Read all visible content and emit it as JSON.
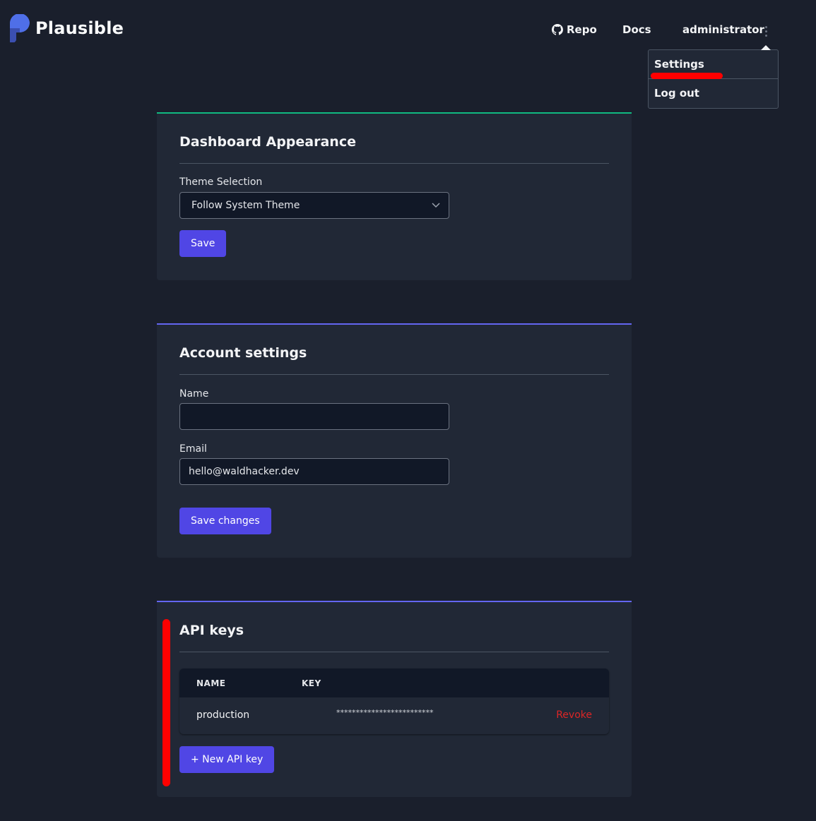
{
  "header": {
    "brand": "Plausible",
    "nav": {
      "repo": "Repo",
      "docs": "Docs",
      "user": "administrator"
    }
  },
  "user_menu": {
    "items": [
      {
        "label": "Settings"
      },
      {
        "label": "Log out"
      }
    ]
  },
  "appearance": {
    "title": "Dashboard Appearance",
    "theme_label": "Theme Selection",
    "theme_value": "Follow System Theme",
    "save": "Save",
    "accent": "#10b981"
  },
  "account": {
    "title": "Account settings",
    "name_label": "Name",
    "name_value": "",
    "email_label": "Email",
    "email_value": "hello@waldhacker.dev",
    "save": "Save changes",
    "accent": "#6366f1"
  },
  "api_keys": {
    "title": "API keys",
    "columns": [
      "NAME",
      "KEY"
    ],
    "rows": [
      {
        "name": "production",
        "key": "*************************",
        "action": "Revoke"
      }
    ],
    "new_button": "+ New API key",
    "accent": "#6366f1"
  },
  "colors": {
    "background": "#1a1f2c",
    "card": "#212836",
    "button": "#5046e5",
    "danger": "#dc2626",
    "annotation": "#ff0000"
  }
}
